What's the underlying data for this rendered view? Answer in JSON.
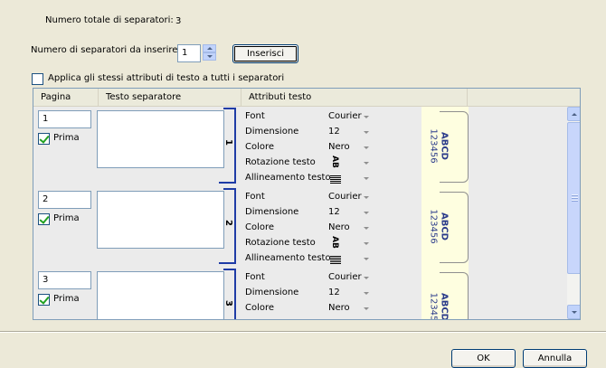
{
  "header": {
    "total_label": "Numero totale di separatori:",
    "total_value": "3",
    "insert_count_label": "Numero di separatori da inserire:",
    "insert_count_value": "1",
    "insert_button": "Inserisci",
    "apply_all_label": "Applica gli stessi attributi di testo a tutti i separatori",
    "apply_all_checked": false
  },
  "table": {
    "columns": [
      "Pagina",
      "Testo separatore",
      "Attributi testo"
    ],
    "attr_labels": [
      "Font",
      "Dimensione",
      "Colore",
      "Rotazione testo",
      "Allineamento testo"
    ],
    "rows": [
      {
        "page": "1",
        "first_label": "Prima",
        "first_checked": true,
        "text": "",
        "index": "1",
        "font": "Courier",
        "size": "12",
        "color": "Nero",
        "rotation_icon": "ab-rotated-icon",
        "align_icon": "align-justify-icon",
        "tab_text_1": "ABCD",
        "tab_text_2": "123456"
      },
      {
        "page": "2",
        "first_label": "Prima",
        "first_checked": true,
        "text": "",
        "index": "2",
        "font": "Courier",
        "size": "12",
        "color": "Nero",
        "rotation_icon": "ab-rotated-icon",
        "align_icon": "align-justify-icon",
        "tab_text_1": "ABCD",
        "tab_text_2": "123456"
      },
      {
        "page": "3",
        "first_label": "Prima",
        "first_checked": true,
        "text": "",
        "index": "3",
        "font": "Courier",
        "size": "12",
        "color": "Nero",
        "tab_text_1": "ABCD",
        "tab_text_2": "12345"
      }
    ],
    "rotation_text": "AB"
  },
  "footer": {
    "ok_button": "OK",
    "cancel_button": "Annulla"
  },
  "colors": {
    "dialog_bg": "#ece9d8",
    "bracket_blue": "#1f3ca6",
    "tab_bg": "#fefee0",
    "scroll_blue": "#c1d3fb"
  }
}
